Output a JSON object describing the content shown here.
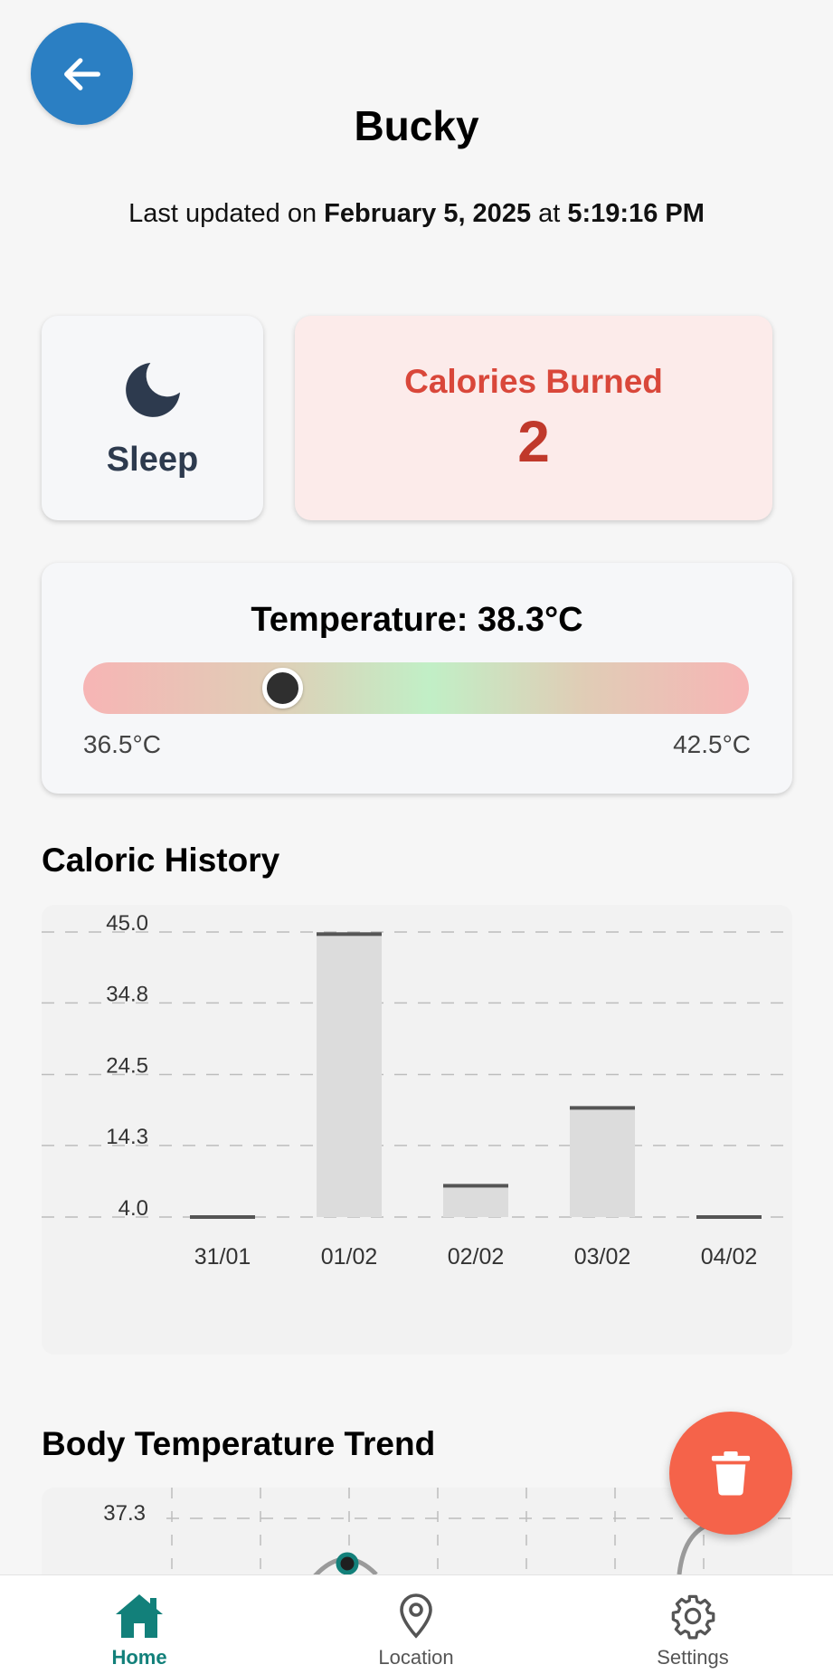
{
  "header": {
    "back_icon": "arrow-left-icon",
    "title": "Bucky",
    "updated_prefix": "Last updated on ",
    "updated_date": "February 5, 2025",
    "updated_mid": " at ",
    "updated_time": "5:19:16 PM"
  },
  "sleep_card": {
    "icon": "moon-icon",
    "label": "Sleep"
  },
  "calories_card": {
    "label": "Calories Burned",
    "value": "2"
  },
  "temperature_card": {
    "label": "Temperature: 38.3°C",
    "current": 38.3,
    "min": 36.5,
    "max": 42.5,
    "min_label": "36.5°C",
    "max_label": "42.5°C"
  },
  "caloric_history": {
    "title": "Caloric History"
  },
  "body_temp_trend": {
    "title": "Body Temperature Trend"
  },
  "chart_data": [
    {
      "type": "bar",
      "categories": [
        "31/01",
        "01/02",
        "02/02",
        "03/02",
        "04/02"
      ],
      "values": [
        4.0,
        44.7,
        8.5,
        19.7,
        4.0
      ],
      "yticks": [
        "45.0",
        "34.8",
        "24.5",
        "14.3",
        "4.0"
      ],
      "ylim": [
        4.0,
        45.0
      ],
      "grid": true
    },
    {
      "type": "line",
      "yticks": [
        "37.3"
      ],
      "grid": true
    }
  ],
  "fab": {
    "icon": "trash-icon"
  },
  "nav": [
    {
      "label": "Home",
      "icon": "home-icon",
      "active": true
    },
    {
      "label": "Location",
      "icon": "location-pin-icon",
      "active": false
    },
    {
      "label": "Settings",
      "icon": "gear-icon",
      "active": false
    }
  ],
  "colors": {
    "accent": "#12807a",
    "back_button": "#2b7fc3",
    "calories_text": "#d9473a",
    "fab": "#f5634a",
    "bar_fill": "#dcdcdc",
    "bar_cap": "#555555"
  }
}
